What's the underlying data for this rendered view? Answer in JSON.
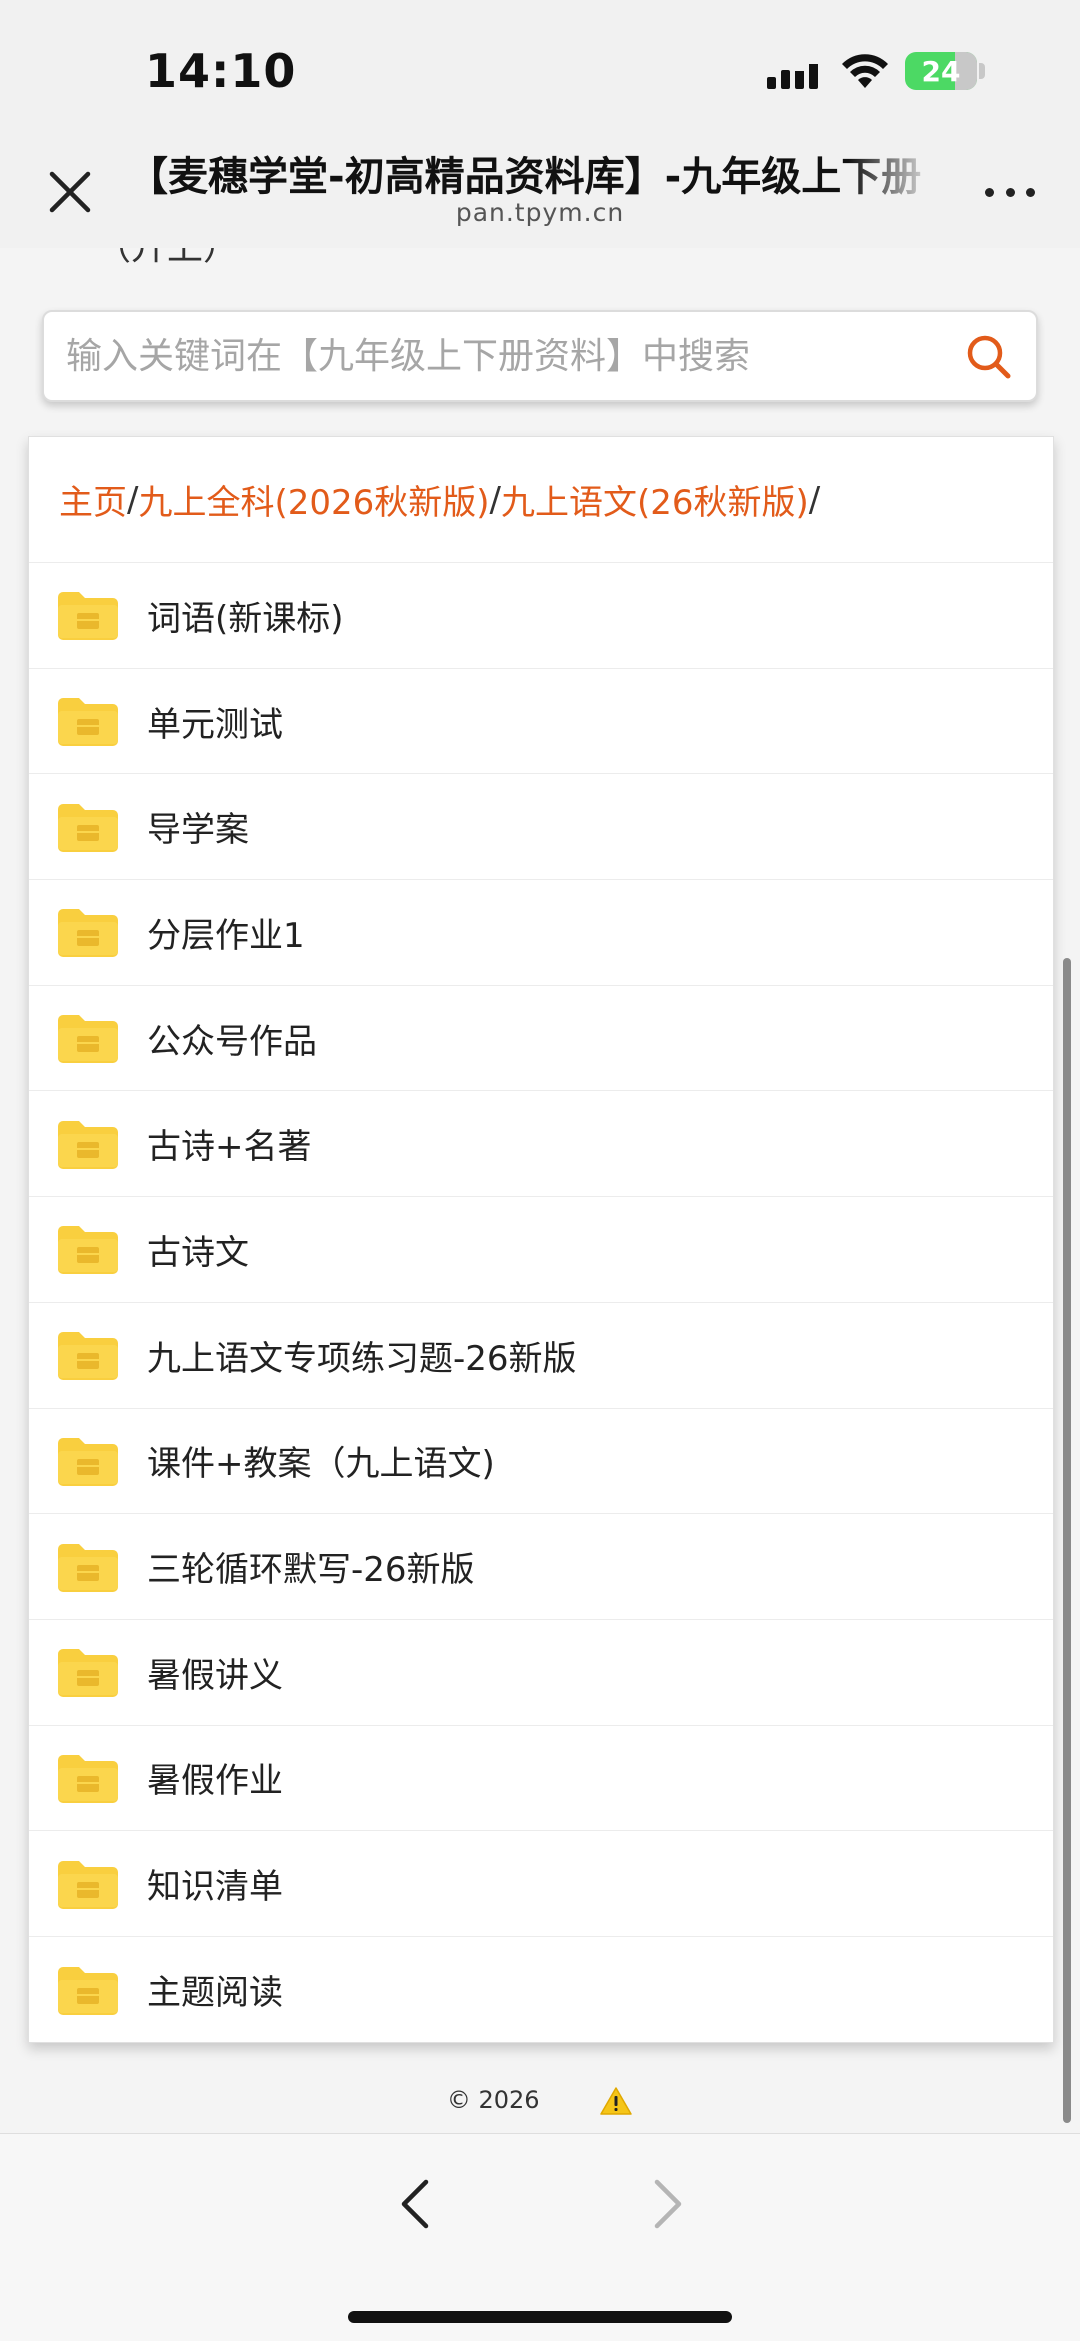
{
  "status_bar": {
    "time": "14:10",
    "battery": "24"
  },
  "header": {
    "title": "【麦穗学堂-初高精品资料库】-九年级上下册",
    "url": "pan.tpym.cn"
  },
  "page": {
    "cut_text": "（升上）"
  },
  "search": {
    "placeholder": "输入关键词在【九年级上下册资料】中搜索",
    "value": ""
  },
  "breadcrumb": [
    "主页",
    "九上全科(2026秋新版)",
    "九上语文(26秋新版)"
  ],
  "files": [
    "词语(新课标)",
    "单元测试",
    "导学案",
    "分层作业1",
    "公众号作品",
    "古诗+名著",
    "古诗文",
    "九上语文专项练习题-26新版",
    "课件+教案（九上语文)",
    "三轮循环默写-26新版",
    "暑假讲义",
    "暑假作业",
    "知识清单",
    "主题阅读"
  ],
  "footer": {
    "copyright": "© 2026"
  },
  "colors": {
    "accent": "#e25b1a",
    "folder": "#f9cf3f",
    "battery": "#4cd964"
  }
}
